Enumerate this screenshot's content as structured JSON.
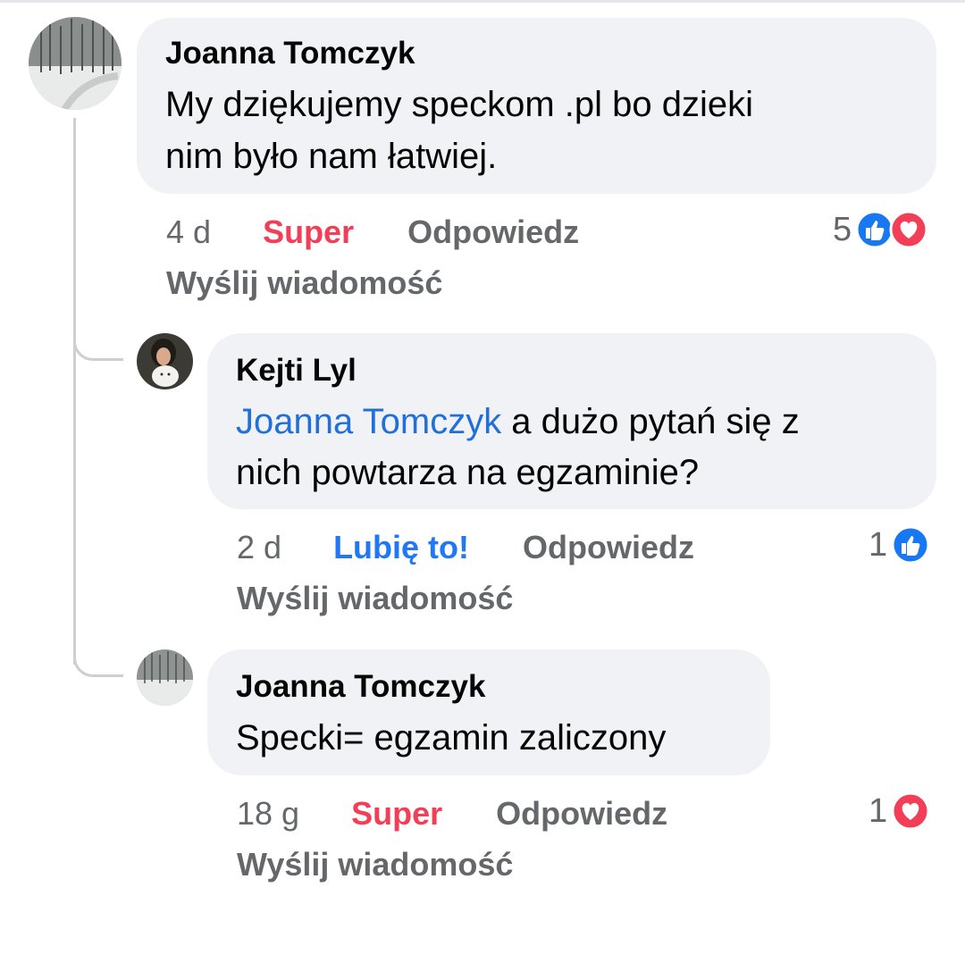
{
  "comments": [
    {
      "author": "Joanna Tomczyk",
      "lines": [
        "My dziękujemy  speckom .pl bo dzieki",
        "nim było  nam łatwiej."
      ],
      "time": "4 d",
      "reaction_label": "Super",
      "reply_label": "Odpowiedz",
      "message_label": "Wyślij wiadomość",
      "reaction_count": "5",
      "reaction_icons": [
        "like-icon",
        "love-icon"
      ]
    },
    {
      "author": "Kejti Lyl",
      "mention": "Joanna Tomczyk",
      "line1_rest": " a dużo pytań się z",
      "line2": "nich powtarza na egzaminie?",
      "time": "2 d",
      "reaction_label": "Lubię to!",
      "reply_label": "Odpowiedz",
      "message_label": "Wyślij wiadomość",
      "reaction_count": "1",
      "reaction_icons": [
        "like-icon"
      ]
    },
    {
      "author": "Joanna Tomczyk",
      "lines": [
        "Specki= egzamin zaliczony"
      ],
      "time": "18 g",
      "reaction_label": "Super",
      "reply_label": "Odpowiedz",
      "message_label": "Wyślij wiadomość",
      "reaction_count": "1",
      "reaction_icons": [
        "love-icon"
      ]
    }
  ],
  "colors": {
    "bubble": "#f0f2f5",
    "super": "#f33e58",
    "like": "#2078f4",
    "mention": "#216fdb",
    "secondary_text": "#65676b"
  }
}
